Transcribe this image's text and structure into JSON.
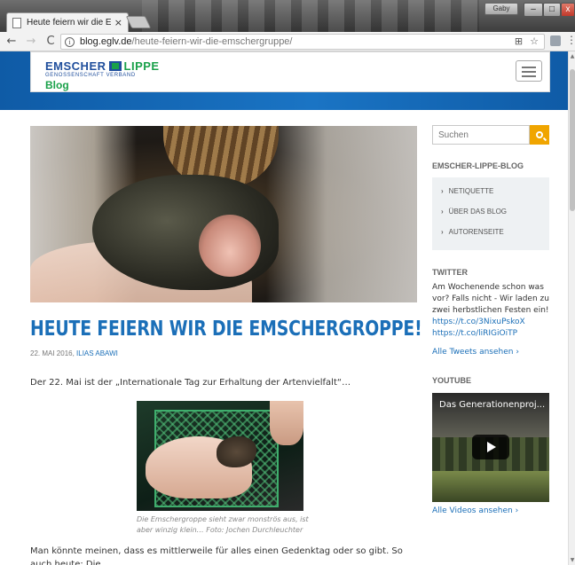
{
  "browser": {
    "tab_title": "Heute feiern wir die Ems",
    "tab_close": "×",
    "user_badge": "Gaby",
    "win_min": "–",
    "win_max": "□",
    "win_close": "x",
    "back": "←",
    "forward": "→",
    "reload": "C",
    "url_host": "blog.eglv.de",
    "url_path": "/heute-feiern-wir-die-emschergruppe/",
    "info_glyph": "i",
    "translate_glyph": "⊞",
    "star_glyph": "☆",
    "menu_glyph": "⋮"
  },
  "site": {
    "logo_emscher": "EMSCHER",
    "logo_lippe": "LIPPE",
    "logo_sub": "GENOSSENSCHAFT  VERBAND",
    "logo_blog": "Blog"
  },
  "post": {
    "title": "HEUTE FEIERN WIR DIE EMSCHERGROPPE!",
    "date": "22. MAI 2016, ",
    "author": "ILIAS ABAWI",
    "lead": "Der 22. Mai ist der „Internationale Tag zur Erhaltung der Artenvielfalt“…",
    "caption": "Die Emschergroppe sieht zwar monströs aus, ist aber winzig klein… Foto: Jochen Durchleuchter",
    "body": "Man könnte meinen, dass es mittlerweile für alles einen Gedenktag oder so gibt. So auch heute: Die"
  },
  "sidebar": {
    "search_placeholder": "Suchen",
    "blog_heading": "EMSCHER-LIPPE-BLOG",
    "menu": [
      {
        "label": "NETIQUETTE"
      },
      {
        "label": "ÜBER DAS BLOG"
      },
      {
        "label": "AUTORENSEITE"
      }
    ],
    "chevron": "›",
    "twitter_heading": "TWITTER",
    "tweet_text": "Am Wochenende schon was vor? Falls nicht - Wir laden zu zwei herbstlichen Festen ein!",
    "tweet_link1": "https://t.co/3NixuPskoX",
    "tweet_link2": "https://t.co/liRIGiOiTP",
    "all_tweets": "Alle Tweets ansehen ›",
    "youtube_heading": "YOUTUBE",
    "video_title": "Das Generationenproj...",
    "all_videos": "Alle Videos ansehen ›"
  },
  "icons": {
    "page": "page-icon",
    "info": "info-icon",
    "search": "search-icon",
    "menu": "hamburger-icon",
    "play": "play-icon"
  },
  "colors": {
    "brand_blue": "#1b6fb8",
    "brand_green": "#1aa14a",
    "search_button": "#f0a500"
  }
}
